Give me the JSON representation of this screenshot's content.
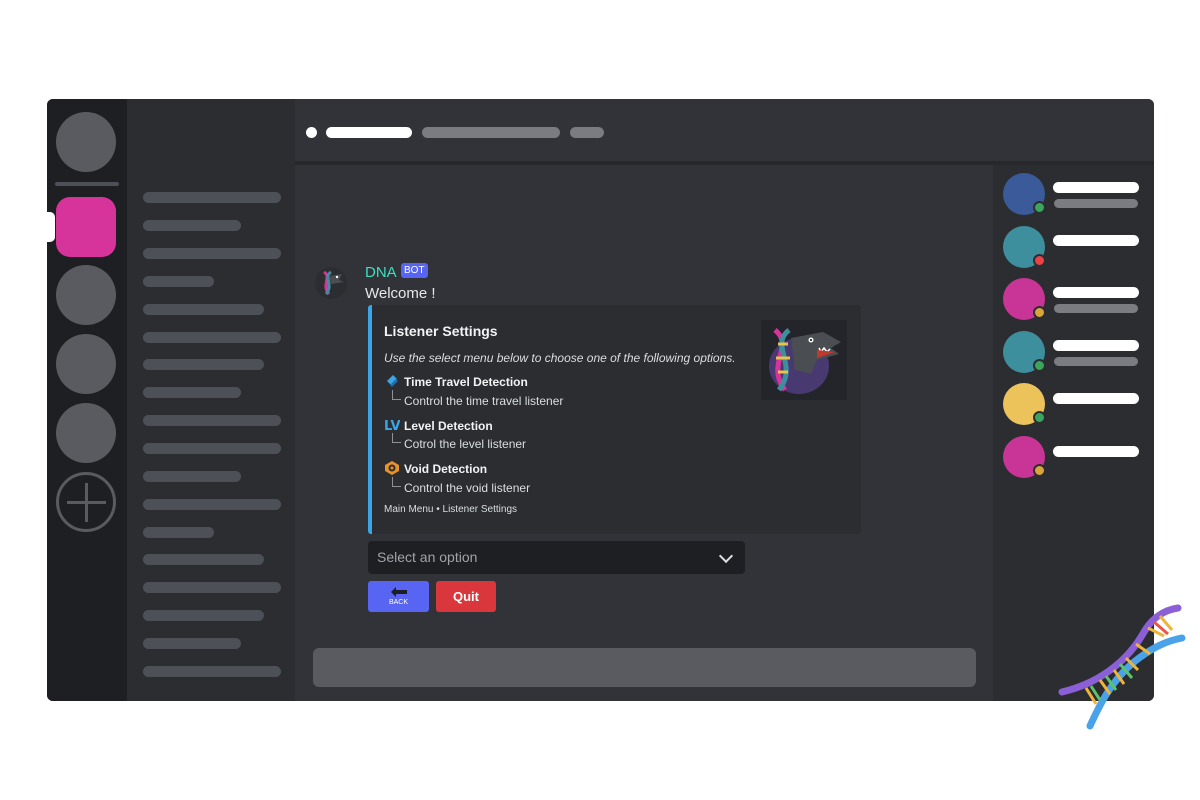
{
  "message": {
    "author": "DNA",
    "bot_tag": "BOT",
    "content": "Welcome !"
  },
  "embed": {
    "title": "Listener Settings",
    "description": "Use the select menu below to choose one of the following options.",
    "options": [
      {
        "icon": "time-travel-icon",
        "name": "Time Travel Detection",
        "description": "Control the time travel listener"
      },
      {
        "icon": "level-lv-icon",
        "name": "Level Detection",
        "description": "Cotrol the level listener"
      },
      {
        "icon": "void-icon",
        "name": "Void Detection",
        "description": "Control the void listener"
      }
    ],
    "footer": "Main Menu • Listener Settings",
    "accent_color": "#3ba5e8",
    "thumbnail": "dna-dinosaur-thumbnail"
  },
  "select_menu": {
    "placeholder": "Select an option"
  },
  "buttons": {
    "back_label": "BACK",
    "quit_label": "Quit"
  },
  "colors": {
    "background": "#313338",
    "active_server": "#d6349b",
    "blurple": "#5865f2",
    "danger": "#da373c",
    "author_name": "#3be0c0"
  },
  "members": [
    {
      "avatar_color": "#3a5a9a",
      "status": "online",
      "status_color": "#3ba55d"
    },
    {
      "avatar_color": "#3e8f9e",
      "status": "dnd",
      "status_color": "#ed4245"
    },
    {
      "avatar_color": "#c93596",
      "status": "idle",
      "status_color": "#d9a53a"
    },
    {
      "avatar_color": "#3e8f9e",
      "status": "online",
      "status_color": "#3ba55d"
    },
    {
      "avatar_color": "#ebc35a",
      "status": "online",
      "status_color": "#3ba55d"
    },
    {
      "avatar_color": "#c93596",
      "status": "idle",
      "status_color": "#d9a53a"
    }
  ]
}
